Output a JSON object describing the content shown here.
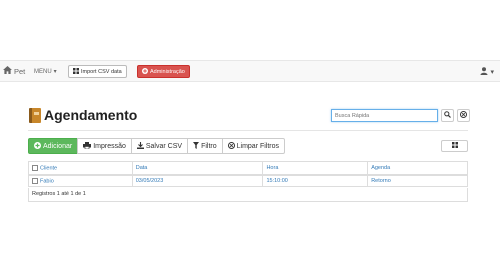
{
  "navbar": {
    "brand": "Pet",
    "menu_label": "MENU",
    "import_label": "Import CSV data",
    "admin_label": "Administração"
  },
  "page": {
    "title": "Agendamento"
  },
  "search": {
    "placeholder": "Busca Rápida"
  },
  "toolbar": {
    "add": "Adicionar",
    "print": "Impressão",
    "save_csv": "Salvar CSV",
    "filter": "Filtro",
    "clear_filters": "Limpar Filtros"
  },
  "table": {
    "columns": [
      "Cliente",
      "Data",
      "Hora",
      "Agenda"
    ],
    "rows": [
      {
        "cliente": "Fabio",
        "data": "03/05/2023",
        "hora": "15:10:00",
        "agenda": "Retorno"
      }
    ],
    "footer": "Registros 1 até 1 de 1"
  },
  "colors": {
    "primary": "#337ab7",
    "success": "#5cb85c",
    "danger": "#d9534f"
  }
}
